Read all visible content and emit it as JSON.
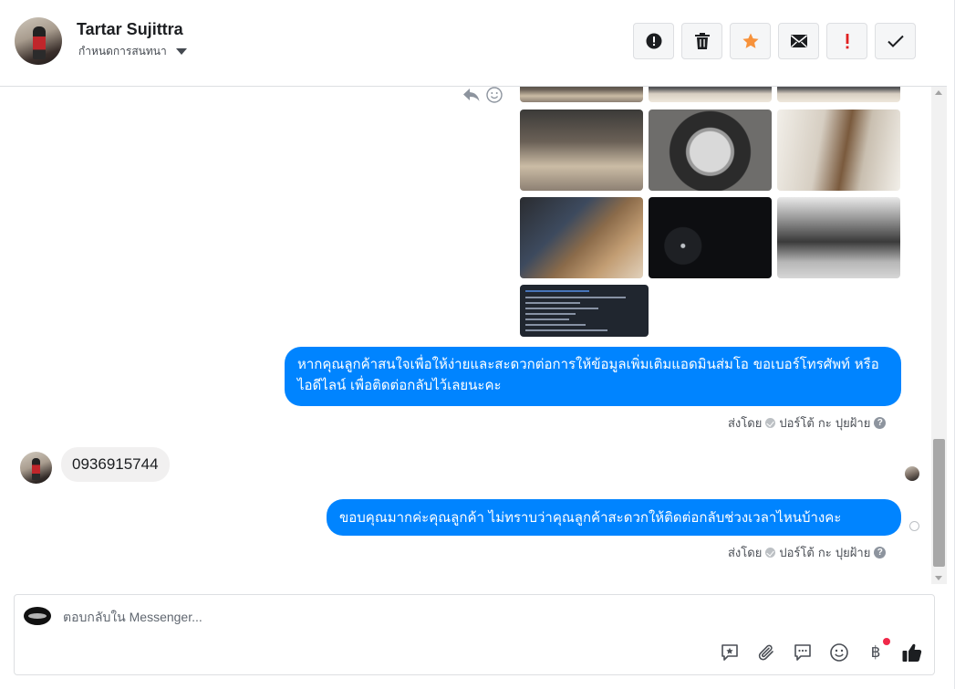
{
  "header": {
    "contact_name": "Tartar Sujittra",
    "assign_label": "กำหนดการสนทนา",
    "actions": [
      {
        "name": "spam-button",
        "icon": "alert-circle-icon"
      },
      {
        "name": "delete-button",
        "icon": "trash-icon"
      },
      {
        "name": "star-button",
        "icon": "star-icon"
      },
      {
        "name": "mark-unread-button",
        "icon": "envelope-icon"
      },
      {
        "name": "follow-up-button",
        "icon": "exclamation-icon"
      },
      {
        "name": "mark-done-button",
        "icon": "checkmark-icon"
      }
    ]
  },
  "messages": [
    {
      "type": "outgoing",
      "text": "หากคุณลูกค้าสนใจเพื่อให้ง่ายและสะดวกต่อการให้ข้อมูลเพิ่มเติมแอดมินส่มโอ ขอเบอร์โทรศัพท์ หรือ ไอดีไลน์ เพื่อติดต่อกลับไว้เลยนะคะ",
      "sent_by_label": "ส่งโดย",
      "sent_by_name": "ปอร์โต้ กะ ปุยฝ้าย"
    },
    {
      "type": "incoming",
      "text": "0936915744"
    },
    {
      "type": "outgoing",
      "text": "ขอบคุณมากค่ะคุณลูกค้า ไม่ทราบว่าคุณลูกค้าสะดวกให้ติดต่อกลับช่วงเวลาไหนบ้างคะ",
      "sent_by_label": "ส่งโดย",
      "sent_by_name": "ปอร์โต้ กะ ปุยฝ้าย"
    }
  ],
  "composer": {
    "placeholder": "ตอบกลับใน Messenger...",
    "tools": [
      "saved-reply-icon",
      "attachment-icon",
      "message-icon",
      "emoji-icon",
      "baht-icon",
      "like-icon"
    ],
    "baht_symbol": "฿"
  },
  "colors": {
    "accent": "#0084ff",
    "incoming_bubble": "#f1f0f0",
    "star": "#f7923b",
    "alert_red": "#e02020",
    "notification_dot": "#f02849"
  }
}
